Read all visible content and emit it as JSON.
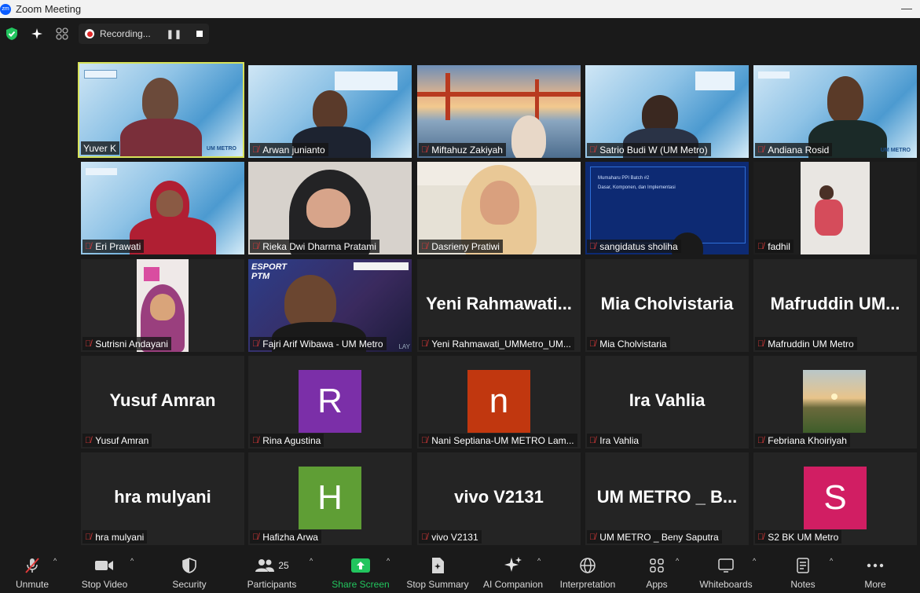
{
  "window": {
    "title": "Zoom Meeting",
    "logo": "zm"
  },
  "topbar": {
    "recording_label": "Recording...",
    "pause_symbol": "❚❚"
  },
  "tiles": [
    {
      "name": "Yuver K",
      "type": "video",
      "active": true
    },
    {
      "name": "Arwan junianto",
      "type": "video"
    },
    {
      "name": "Miftahuz Zakiyah",
      "type": "video"
    },
    {
      "name": "Satrio Budi W (UM Metro)",
      "type": "video"
    },
    {
      "name": "Andiana Rosid",
      "type": "video"
    },
    {
      "name": "Eri Prawati",
      "type": "video"
    },
    {
      "name": "Rieka Dwi Dharma Pratami",
      "type": "video"
    },
    {
      "name": "Dasrieny Pratiwi",
      "type": "video"
    },
    {
      "name": "sangidatus sholiha",
      "type": "screen",
      "slide_title": "Mumaharu PPI Batch #2",
      "slide_subtitle": "Dasar, Komponen, dan Implementasi"
    },
    {
      "name": "fadhil",
      "type": "video"
    },
    {
      "name": "Sutrisni Andayani",
      "type": "video"
    },
    {
      "name": "Fajri Arif Wibawa - UM Metro",
      "type": "video",
      "overlay_text": "ESPORT PTM",
      "corner_text": "LAY"
    },
    {
      "name": "Yeni Rahmawati_UMMetro_UM...",
      "type": "name",
      "display": "Yeni  Rahmawati..."
    },
    {
      "name": "Mia Cholvistaria",
      "type": "name",
      "display": "Mia Cholvistaria"
    },
    {
      "name": "Mafruddin UM Metro",
      "type": "name",
      "display": "Mafruddin  UM..."
    },
    {
      "name": "Yusuf Amran",
      "type": "name",
      "display": "Yusuf Amran"
    },
    {
      "name": "Rina Agustina",
      "type": "avatar",
      "letter": "R",
      "color": "#7b2fa8"
    },
    {
      "name": "Nani Septiana-UM METRO Lam...",
      "type": "avatar",
      "letter": "n",
      "color": "#c1370f"
    },
    {
      "name": "Ira Vahlia",
      "type": "name",
      "display": "Ira Vahlia"
    },
    {
      "name": "Febriana Khoiriyah",
      "type": "photo"
    },
    {
      "name": "hra mulyani",
      "type": "name",
      "display": "hra mulyani"
    },
    {
      "name": "Hafizha Arwa",
      "type": "avatar",
      "letter": "H",
      "color": "#5f9e35"
    },
    {
      "name": "vivo V2131",
      "type": "name",
      "display": "vivo V2131"
    },
    {
      "name": "UM METRO _ Beny Saputra",
      "type": "name",
      "display": "UM  METRO _ B..."
    },
    {
      "name": "S2 BK UM Metro",
      "type": "avatar",
      "letter": "S",
      "color": "#d11e63"
    }
  ],
  "toolbar": {
    "unmute": "Unmute",
    "stop_video": "Stop Video",
    "security": "Security",
    "participants": "Participants",
    "participants_count": "25",
    "share_screen": "Share Screen",
    "stop_summary": "Stop Summary",
    "ai_companion": "AI Companion",
    "interpretation": "Interpretation",
    "apps": "Apps",
    "whiteboards": "Whiteboards",
    "notes": "Notes",
    "more": "More"
  },
  "colors": {
    "accent_green": "#22c55e",
    "active_speaker": "#d7e25a",
    "muted_red": "#e03a3a"
  }
}
